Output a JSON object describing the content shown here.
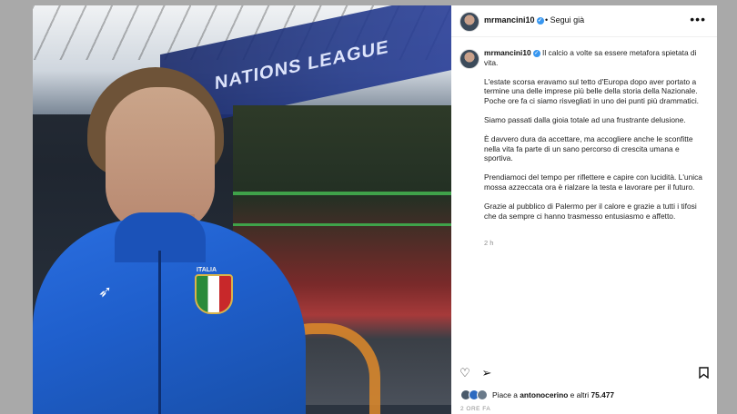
{
  "post": {
    "username": "mrmancini10",
    "follow_label": "Segui già",
    "more_icon": "more-horizontal-icon",
    "photo": {
      "banner_text": "NATIONS LEAGUE",
      "crest_text": "ITALIA"
    },
    "caption": {
      "lead": "Il calcio a volte sa essere metafora spietata di vita.",
      "paragraphs": [
        "L'estate scorsa eravamo sul tetto d'Europa dopo aver portato a termine una delle imprese più belle della storia della Nazionale. Poche ore fa ci siamo risvegliati in uno dei punti più drammatici.",
        "Siamo passati dalla gioia totale ad una frustrante delusione.",
        "È davvero dura da accettare, ma accogliere anche le sconfitte nella vita fa parte di un sano percorso di crescita umana e sportiva.",
        "Prendiamoci del tempo per riflettere e capire con lucidità. L'unica mossa azzeccata ora è rialzare la testa e lavorare per il futuro.",
        "Grazie al pubblico di Palermo per il calore e grazie a tutti i tifosi che da sempre ci hanno trasmesso entusiasmo e affetto."
      ],
      "time": "2 h"
    },
    "likes": {
      "text_prefix": "Piace a ",
      "liker": "antonocerino",
      "text_mid": " e altri ",
      "count": "75.477"
    },
    "posted_ago": "2 ORE FA"
  },
  "colors": {
    "verified": "#3897f0",
    "text": "#111111",
    "muted": "#8e8e8e"
  }
}
